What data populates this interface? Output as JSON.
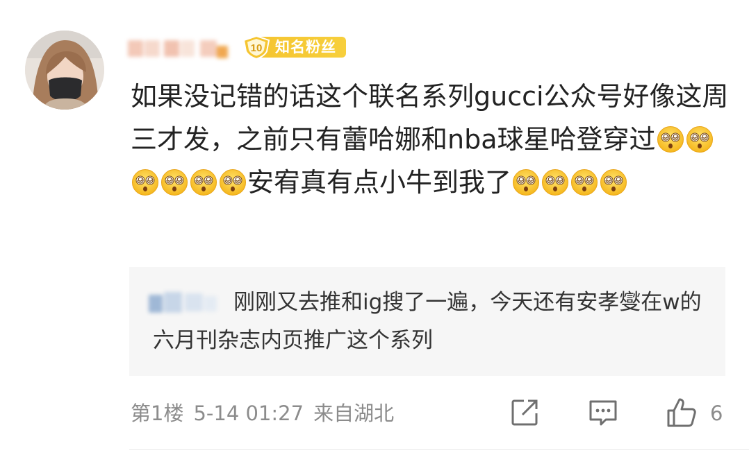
{
  "comment": {
    "badge": {
      "level": "10",
      "label": "知名粉丝",
      "color": "#f5c531"
    },
    "text_parts": [
      "如果没记错的话这个联名系列gucci公众号好像这周三才发，之前只有蕾哈娜和nba球星哈登穿过",
      "安宥真有点小牛到我了"
    ],
    "emoji": "dizzy-face-emoji",
    "emoji_run_1": 6,
    "emoji_run_2": 4
  },
  "reply": {
    "text": "刚刚又去推和ig搜了一遍，今天还有安孝燮在w的六月刊杂志内页推广这个系列"
  },
  "footer": {
    "floor": "第1楼",
    "time": "5-14 01:27",
    "location": "来自湖北",
    "like_count": "6"
  },
  "icons": [
    "share-icon",
    "comment-icon",
    "thumbs-up-icon"
  ]
}
